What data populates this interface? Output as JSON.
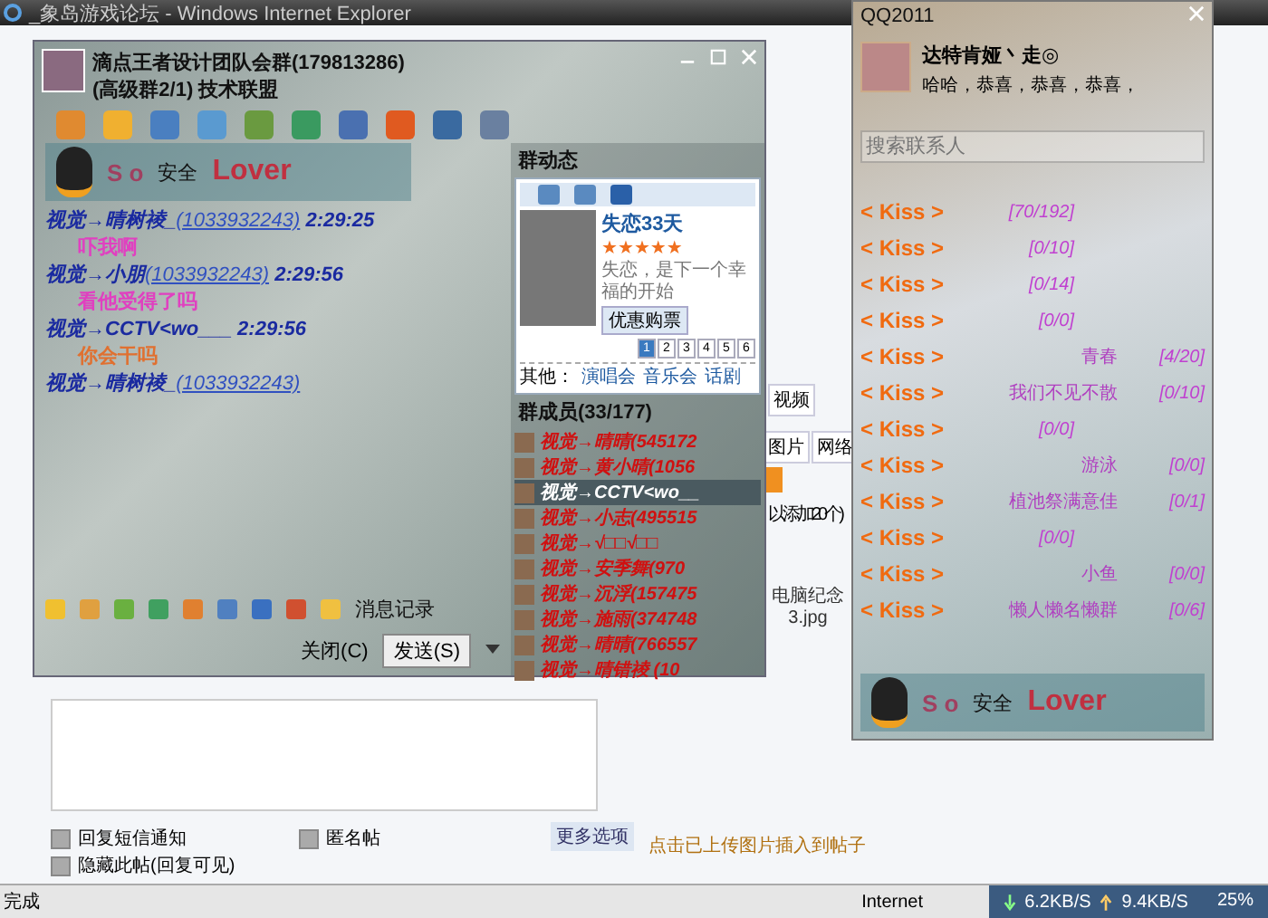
{
  "browser": {
    "title": "_象岛游戏论坛 - Windows Internet Explorer",
    "status": "完成",
    "zone": "Internet",
    "down_speed": "6.2KB/S",
    "up_speed": "9.4KB/S",
    "zoom": "25%"
  },
  "page": {
    "tab_video": "视频",
    "tab_image": "图片",
    "tab_network": "网络",
    "add_hint": "以添加20个)",
    "file_name": "电脑纪念3.jpg",
    "options": [
      {
        "label": "回复短信通知",
        "checked": false
      },
      {
        "label": "匿名帖",
        "checked": false
      },
      {
        "label": "隐藏此帖(回复可见)",
        "checked": false
      }
    ],
    "more_button": "更多选项",
    "upload_tip": "点击已上传图片插入到帖子"
  },
  "group_chat": {
    "title": "滴点王者设计团队会群(179813286)",
    "subtitle": "(高级群2/1) 技术联盟",
    "logo": {
      "left": "S o",
      "middle": "安全",
      "right": "Lover"
    },
    "messages": [
      {
        "sender": "视觉→晴树祾_",
        "qq": "(1033932243)",
        "time": "2:29:25",
        "text": "吓我啊",
        "color": "#e040c0"
      },
      {
        "sender": "视觉→小朋",
        "qq": "(1033932243)",
        "time": "2:29:56",
        "text": "看他受得了吗",
        "color": "#e040c0"
      },
      {
        "sender": "视觉→CCTV<wo___",
        "time": "2:29:56",
        "text": "你会干吗",
        "color": "#e07030"
      },
      {
        "sender": "视觉→晴树祾_",
        "qq": "(1033932243)"
      }
    ],
    "history_button": "消息记录",
    "close_button": "关闭(C)",
    "send_button": "发送(S)",
    "dynamics": {
      "title": "群动态",
      "movie": "失恋33天",
      "stars": 5,
      "blurb": "失恋，是下一个幸福的开始",
      "buy_button": "优惠购票",
      "pages": [
        {
          "label": "1",
          "selected": true
        },
        {
          "label": "2",
          "selected": false
        },
        {
          "label": "3",
          "selected": false
        },
        {
          "label": "4",
          "selected": false
        },
        {
          "label": "5",
          "selected": false
        },
        {
          "label": "6",
          "selected": false
        }
      ],
      "other_label": "其他：",
      "other_links": [
        "演唱会",
        "音乐会",
        "话剧"
      ]
    },
    "members_title": "群成员(33/177)",
    "members": [
      {
        "name": "视觉→晴晴(545172",
        "selected": false
      },
      {
        "name": "视觉→黄小晴(1056",
        "selected": false
      },
      {
        "name": "视觉→CCTV<wo__",
        "selected": true
      },
      {
        "name": "视觉→小志(495515",
        "selected": false
      },
      {
        "name": "视觉→√□□√□□",
        "selected": false
      },
      {
        "name": "视觉→安季舞(970",
        "selected": false
      },
      {
        "name": "视觉→沉浮(157475",
        "selected": false
      },
      {
        "name": "视觉→施雨(374748",
        "selected": false
      },
      {
        "name": "视觉→晴晴(766557",
        "selected": false
      },
      {
        "name": "视觉→晴错祾 (10",
        "selected": false
      }
    ]
  },
  "qq_panel": {
    "title": "QQ2011",
    "nickname": "达特肯娅丶走◎",
    "signature": "哈哈，恭喜，恭喜，恭喜，",
    "search_placeholder": "搜索联系人",
    "logo": {
      "left": "S o",
      "middle": "安全",
      "right": "Lover"
    },
    "groups": [
      {
        "name": "< Kiss >",
        "count": "[70/192]"
      },
      {
        "name": "< Kiss >",
        "count": "[0/10]"
      },
      {
        "name": "< Kiss >",
        "count": "[0/14]"
      },
      {
        "name": "< Kiss >",
        "count": "[0/0]"
      },
      {
        "name": "< Kiss >",
        "label": "青春",
        "count": "[4/20]"
      },
      {
        "name": "< Kiss >",
        "label": "我们不见不散",
        "count": "[0/10]"
      },
      {
        "name": "< Kiss >",
        "count": "[0/0]"
      },
      {
        "name": "< Kiss >",
        "label": "游泳",
        "count": "[0/0]"
      },
      {
        "name": "< Kiss >",
        "label": "植池祭满意佳",
        "count": "[0/1]"
      },
      {
        "name": "< Kiss >",
        "count": "[0/0]"
      },
      {
        "name": "< Kiss >",
        "label": "小鱼",
        "count": "[0/0]"
      },
      {
        "name": "< Kiss >",
        "label": "懒人懒名懒群",
        "count": "[0/6]"
      }
    ]
  }
}
